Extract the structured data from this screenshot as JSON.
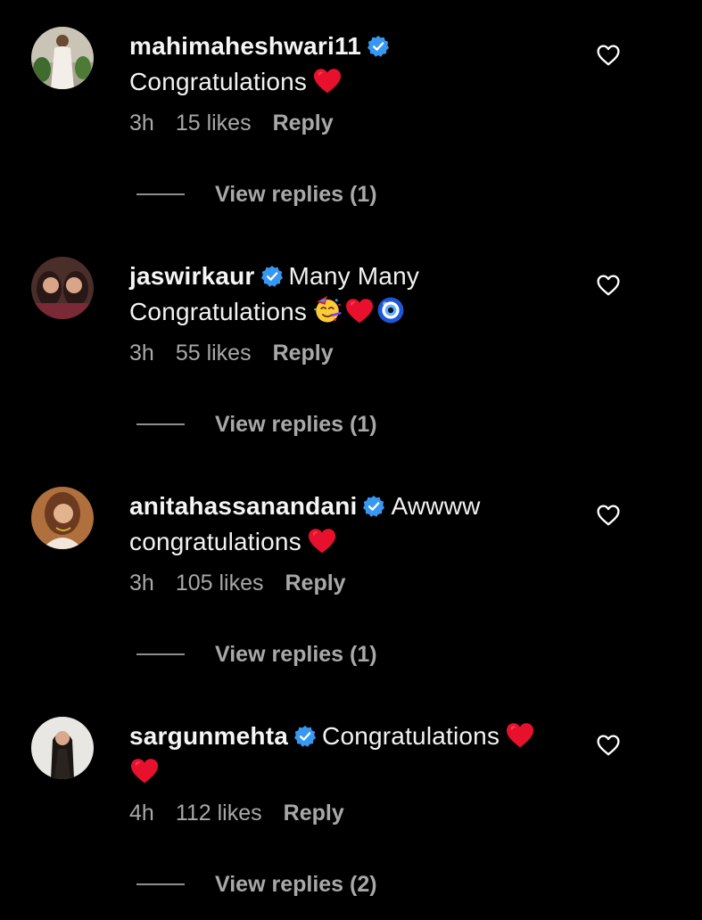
{
  "colors": {
    "background": "#000000",
    "verified_badge": "#3897f0",
    "heart_emoji": "#e8112d",
    "secondary_text": "#a8a8a8"
  },
  "comments": [
    {
      "username": "mahimaheshwari11",
      "text": "Congratulations",
      "emojis": [
        "red-heart"
      ],
      "time": "3h",
      "likes": "15 likes",
      "reply_label": "Reply",
      "view_replies": "View replies (1)"
    },
    {
      "username": "jaswirkaur",
      "text": "Many Many Congratulations",
      "emojis": [
        "partying-face",
        "red-heart",
        "nazar-amulet"
      ],
      "time": "3h",
      "likes": "55 likes",
      "reply_label": "Reply",
      "view_replies": "View replies (1)"
    },
    {
      "username": "anitahassanandani",
      "text": "Awwww congratulations",
      "emojis": [
        "red-heart"
      ],
      "time": "3h",
      "likes": "105 likes",
      "reply_label": "Reply",
      "view_replies": "View replies (1)"
    },
    {
      "username": "sargunmehta",
      "text": "Congratulations",
      "emojis": [
        "red-heart",
        "red-heart"
      ],
      "time": "4h",
      "likes": "112 likes",
      "reply_label": "Reply",
      "view_replies": "View replies (2)"
    }
  ]
}
